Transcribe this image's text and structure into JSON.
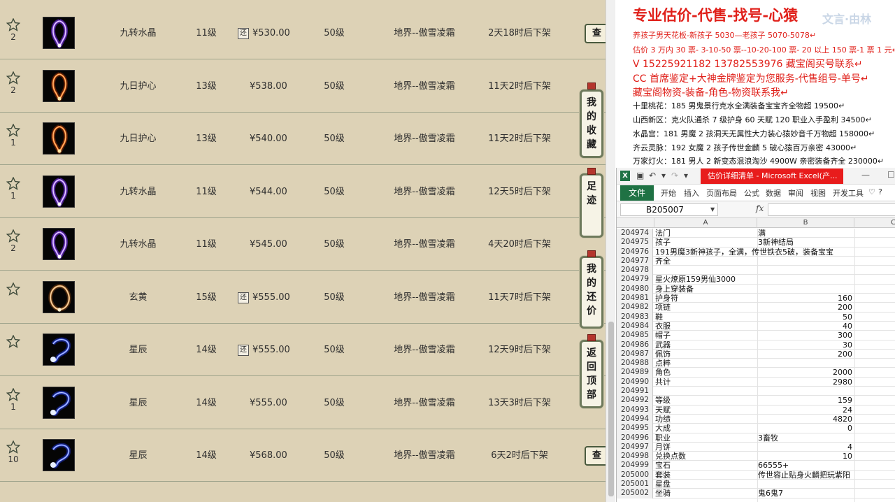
{
  "market": {
    "server_prefix": "地界--傲雪凌霜",
    "rows": [
      {
        "fav": "2",
        "name": "九转水晶",
        "level": "11级",
        "price": "¥530.00",
        "huan": true,
        "req": "50级",
        "server": "地界--傲雪凌霜",
        "time": "2天18时后下架",
        "art": "violet",
        "cha": "查"
      },
      {
        "fav": "2",
        "name": "九日护心",
        "level": "13级",
        "price": "¥538.00",
        "huan": false,
        "req": "50级",
        "server": "地界--傲雪凌霜",
        "time": "11天2时后下架",
        "art": "fire",
        "cha": ""
      },
      {
        "fav": "1",
        "name": "九日护心",
        "level": "13级",
        "price": "¥540.00",
        "huan": false,
        "req": "50级",
        "server": "地界--傲雪凌霜",
        "time": "11天2时后下架",
        "art": "fire",
        "cha": ""
      },
      {
        "fav": "1",
        "name": "九转水晶",
        "level": "11级",
        "price": "¥544.00",
        "huan": false,
        "req": "50级",
        "server": "地界--傲雪凌霜",
        "time": "12天5时后下架",
        "art": "violet",
        "cha": ""
      },
      {
        "fav": "2",
        "name": "九转水晶",
        "level": "11级",
        "price": "¥545.00",
        "huan": false,
        "req": "50级",
        "server": "地界--傲雪凌霜",
        "time": "4天20时后下架",
        "art": "violet",
        "cha": ""
      },
      {
        "fav": "",
        "name": "玄黄",
        "level": "15级",
        "price": "¥555.00",
        "huan": true,
        "req": "50级",
        "server": "地界--傲雪凌霜",
        "time": "11天7时后下架",
        "art": "gold",
        "cha": ""
      },
      {
        "fav": "",
        "name": "星辰",
        "level": "14级",
        "price": "¥555.00",
        "huan": true,
        "req": "50级",
        "server": "地界--傲雪凌霜",
        "time": "12天9时后下架",
        "art": "blue",
        "cha": ""
      },
      {
        "fav": "1",
        "name": "星辰",
        "level": "14级",
        "price": "¥555.00",
        "huan": false,
        "req": "50级",
        "server": "地界--傲雪凌霜",
        "time": "13天3时后下架",
        "art": "blue",
        "cha": ""
      },
      {
        "fav": "10",
        "name": "星辰",
        "level": "14级",
        "price": "¥568.00",
        "huan": false,
        "req": "50级",
        "server": "地界--傲雪凌霜",
        "time": "6天2时后下架",
        "art": "blue",
        "cha": "查"
      }
    ],
    "huan_label": "还",
    "side_buttons": [
      {
        "label": "我的收藏",
        "chars": [
          "我",
          "的",
          "收",
          "藏"
        ]
      },
      {
        "label": "足迹",
        "chars": [
          "足",
          "迹"
        ]
      },
      {
        "label": "我的还价",
        "chars": [
          "我",
          "的",
          "还",
          "价"
        ]
      },
      {
        "label": "返回顶部",
        "chars": [
          "返",
          "回",
          "顶",
          "部"
        ]
      }
    ]
  },
  "promo": {
    "title": "专业估价-代售-找号-心猿",
    "watermark": "文言·由林",
    "lines": [
      {
        "text": "养孩子男天花板-新孩子 5030—老孩子 5070-5078↵",
        "cls": "red"
      },
      {
        "text": "估价 3 万内 30 票- 3-10-50 票--10-20-100 票- 20 以上 150 票-1 票 1 元↵",
        "cls": "red"
      },
      {
        "text": "V 15225921182      13782553976    藏宝阁买号联系↵",
        "cls": "red big"
      },
      {
        "text": "CC 首席鉴定+大神金牌鉴定为您服务-代售组号-单号↵",
        "cls": "red big"
      },
      {
        "text": "藏宝阁物资-装备-角色-物资联系我↵",
        "cls": "red big"
      },
      {
        "text": "十里桃花：185 男鬼景行克水全满装备宝宝齐全物超 19500↵",
        "cls": "blk"
      },
      {
        "text": "山西新区：克火队通杀 7 级护身 60 天赋 120 职业入手盈利 34500↵",
        "cls": "blk"
      },
      {
        "text": "水晶宫：181 男魔 2 孩洞天无属性大力装心猿妙音千万物超 158000↵",
        "cls": "blk"
      },
      {
        "text": "齐云灵脉：192 女魔 2 孩子传世金麟 5 破心猿百万亲密 43000↵",
        "cls": "blk"
      },
      {
        "text": "万家灯火：181 男人 2 新变态混浪淘沙 4900W 亲密装备齐全 230000↵",
        "cls": "blk"
      }
    ]
  },
  "excel": {
    "window_title": "估价详细清单 - Microsoft Excel(产...",
    "tabs": [
      "开始",
      "插入",
      "页面布局",
      "公式",
      "数据",
      "审阅",
      "视图",
      "开发工具"
    ],
    "file_tab": "文件",
    "name_box": "B205007",
    "fx": "fx",
    "columns": [
      "A",
      "B",
      "C"
    ],
    "rows": [
      {
        "n": "204974",
        "a": "法门",
        "b": "满",
        "num": false
      },
      {
        "n": "204975",
        "a": "孩子",
        "b": "3新神结局",
        "num": false
      },
      {
        "n": "204976",
        "a": "191男魔3新神孩子，全满，传世铁衣5破，装备宝宝",
        "b": "",
        "num": false
      },
      {
        "n": "204977",
        "a": "齐全",
        "b": "",
        "num": false
      },
      {
        "n": "204978",
        "a": "",
        "b": "",
        "num": false
      },
      {
        "n": "204979",
        "a": "星火燎原159男仙3000",
        "b": "",
        "num": false
      },
      {
        "n": "204980",
        "a": "身上穿装备",
        "b": "",
        "num": false
      },
      {
        "n": "204981",
        "a": "护身符",
        "b": "160",
        "num": true
      },
      {
        "n": "204982",
        "a": "项链",
        "b": "200",
        "num": true
      },
      {
        "n": "204983",
        "a": "鞋",
        "b": "50",
        "num": true
      },
      {
        "n": "204984",
        "a": "衣服",
        "b": "40",
        "num": true
      },
      {
        "n": "204985",
        "a": "帽子",
        "b": "300",
        "num": true
      },
      {
        "n": "204986",
        "a": "武器",
        "b": "30",
        "num": true
      },
      {
        "n": "204987",
        "a": "佩饰",
        "b": "200",
        "num": true
      },
      {
        "n": "204988",
        "a": "点粹",
        "b": "",
        "num": false
      },
      {
        "n": "204989",
        "a": "角色",
        "b": "2000",
        "num": true
      },
      {
        "n": "204990",
        "a": "共计",
        "b": "2980",
        "num": true
      },
      {
        "n": "204991",
        "a": "",
        "b": "",
        "num": false
      },
      {
        "n": "204992",
        "a": "等级",
        "b": "159",
        "num": true
      },
      {
        "n": "204993",
        "a": "天赋",
        "b": "24",
        "num": true
      },
      {
        "n": "204994",
        "a": "功绩",
        "b": "4820",
        "num": true
      },
      {
        "n": "204995",
        "a": "大成",
        "b": "0",
        "num": true
      },
      {
        "n": "204996",
        "a": "职业",
        "b": "3畜牧",
        "num": false
      },
      {
        "n": "204997",
        "a": "月饼",
        "b": "4",
        "num": true
      },
      {
        "n": "204998",
        "a": "兑换点数",
        "b": "10",
        "num": true
      },
      {
        "n": "204999",
        "a": "宝石",
        "b": "66555+",
        "num": false
      },
      {
        "n": "205000",
        "a": "套装",
        "b": "传世容止贴身火麟把玩紫阳",
        "num": false
      },
      {
        "n": "205001",
        "a": "星盘",
        "b": "",
        "num": false
      },
      {
        "n": "205002",
        "a": "坐骑",
        "b": "鬼6鬼7",
        "num": false
      }
    ]
  }
}
